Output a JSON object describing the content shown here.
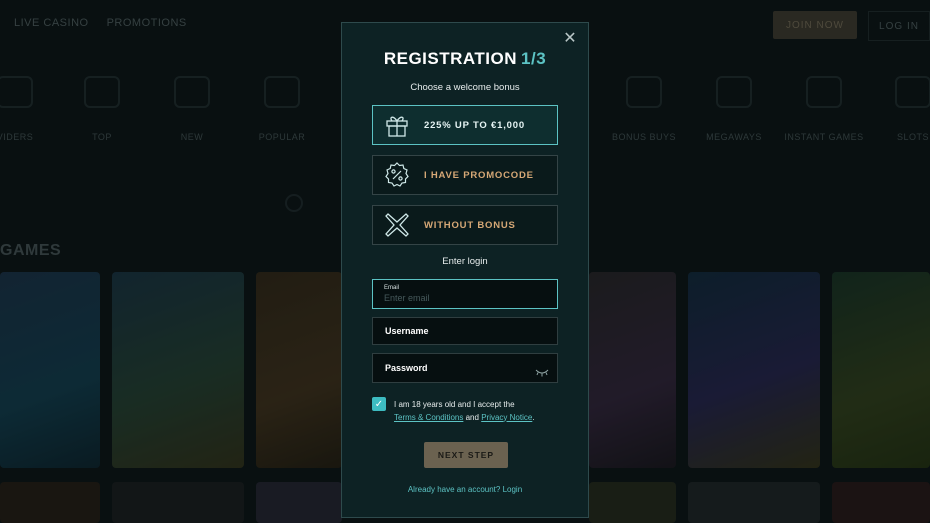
{
  "topbar": {
    "nav": [
      "LIVE CASINO",
      "PROMOTIONS"
    ],
    "join_label": "JOIN NOW",
    "login_label": "LOG IN"
  },
  "categories": [
    "VIDERS",
    "TOP",
    "NEW",
    "POPULAR",
    "BONUS BUYS",
    "MEGAWAYS",
    "INSTANT GAMES",
    "SLOTS"
  ],
  "games_heading": "GAMES",
  "modal": {
    "title": "REGISTRATION",
    "step": "1/3",
    "subtitle": "Choose a welcome bonus",
    "bonuses": [
      {
        "label": "225% UP TO €1,000",
        "icon": "gift-icon",
        "selected": true
      },
      {
        "label": "I HAVE PROMOCODE",
        "icon": "percent-badge-icon",
        "selected": false
      },
      {
        "label": "WITHOUT BONUS",
        "icon": "x-cross-icon",
        "selected": false
      }
    ],
    "enter_login": "Enter login",
    "email": {
      "label": "Email",
      "placeholder": "Enter email",
      "value": ""
    },
    "username": {
      "placeholder": "Username"
    },
    "password": {
      "placeholder": "Password"
    },
    "consent": {
      "checked": true,
      "text_before": "I am 18 years old and I accept the",
      "terms": "Terms & Conditions",
      "and": "and",
      "privacy": "Privacy Notice",
      "period": "."
    },
    "next_label": "NEXT STEP",
    "already_label": "Already have an account? Login"
  },
  "colors": {
    "accent": "#5cc3c4",
    "gold": "#d6a876",
    "modal_bg": "#0d2224",
    "button": "#6b6250"
  }
}
